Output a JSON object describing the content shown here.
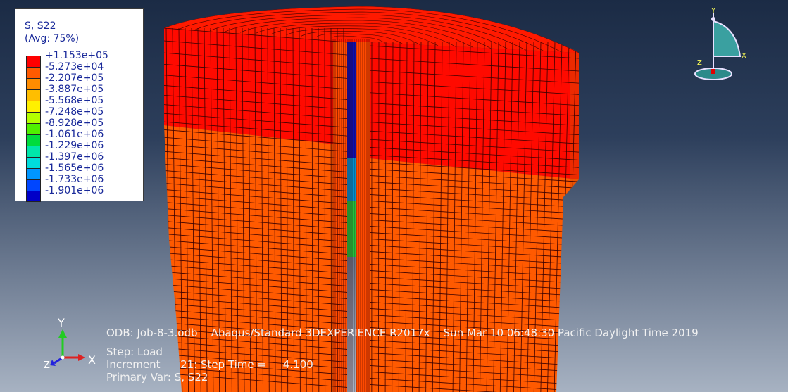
{
  "legend": {
    "title": "S, S22",
    "averaging": "(Avg: 75%)",
    "entries": [
      {
        "label": "+1.153e+05",
        "color": "#ff0000"
      },
      {
        "label": "-5.273e+04",
        "color": "#ff5a00"
      },
      {
        "label": "-2.207e+05",
        "color": "#ff8c00"
      },
      {
        "label": "-3.887e+05",
        "color": "#ffbe00"
      },
      {
        "label": "-5.568e+05",
        "color": "#fff000"
      },
      {
        "label": "-7.248e+05",
        "color": "#b4ff00"
      },
      {
        "label": "-8.928e+05",
        "color": "#50f000"
      },
      {
        "label": "-1.061e+06",
        "color": "#00dc3c"
      },
      {
        "label": "-1.229e+06",
        "color": "#00e6aa"
      },
      {
        "label": "-1.397e+06",
        "color": "#00dcdc"
      },
      {
        "label": "-1.565e+06",
        "color": "#0096ff"
      },
      {
        "label": "-1.733e+06",
        "color": "#0046ff"
      },
      {
        "label": "-1.901e+06",
        "color": "#0000c8"
      }
    ]
  },
  "info": {
    "odb_line": "ODB: Job-8-3.odb    Abaqus/Standard 3DEXPERIENCE R2017x    Sun Mar 10 06:48:30 Pacific Daylight Time 2019",
    "step_line": "Step: Load",
    "increment_line": "Increment      21: Step Time =     4.100",
    "primary_var_line": "Primary Var: S, S22"
  },
  "triad": {
    "x_label": "X",
    "y_label": "Y",
    "z_label": "Z"
  },
  "view_cube": {
    "x_label": "X",
    "y_label": "Y",
    "z_label": "Z"
  }
}
